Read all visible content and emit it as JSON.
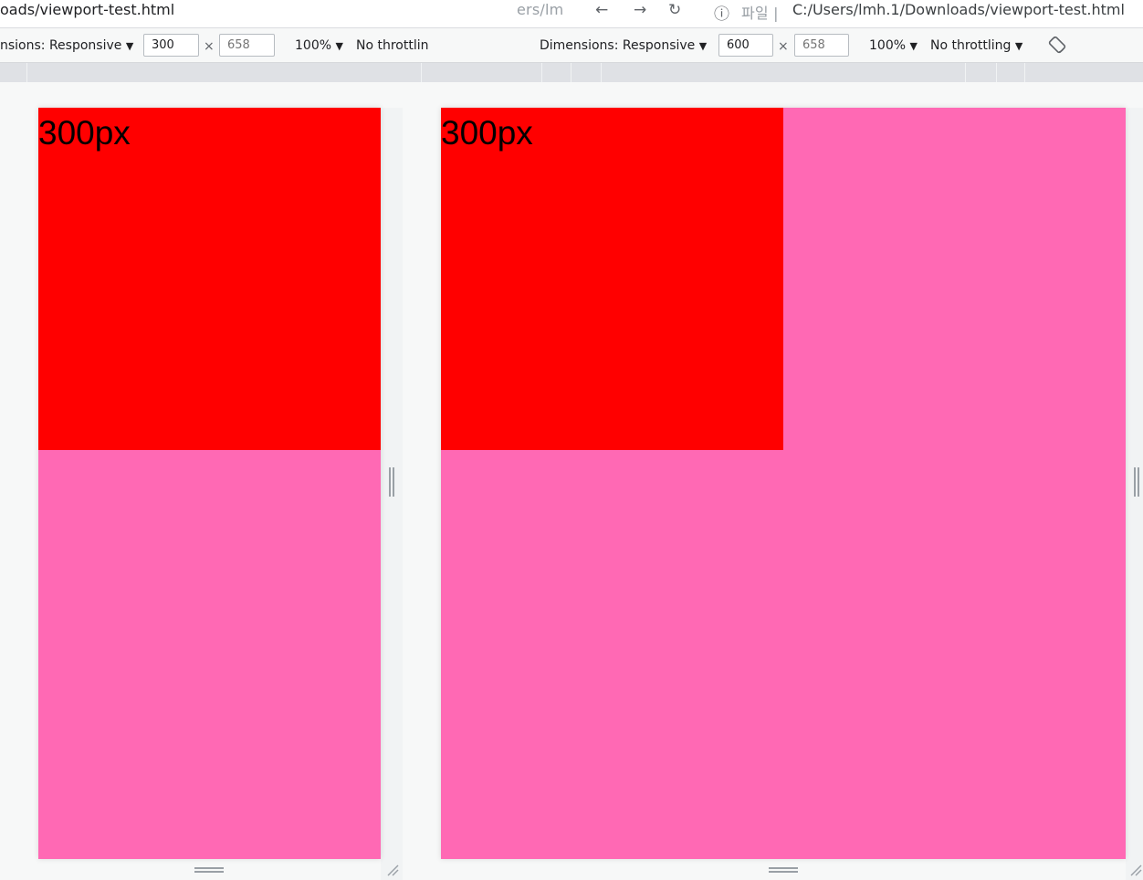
{
  "address_bar": {
    "url_left": "oads/viewport-test.html",
    "url_right": "C:/Users/lmh.1/Downloads/viewport-test.html",
    "ghost_text_a": "ers/lm",
    "ghost_text_b": "파일 |",
    "back_icon": "back-arrow-icon",
    "forward_icon": "forward-arrow-icon",
    "reload_icon": "reload-icon",
    "info_icon": "info-icon"
  },
  "toolbars": [
    {
      "dimensions_label": "nsions: Responsive",
      "width_value": "300",
      "height_placeholder": "658",
      "times": "×",
      "zoom_label": "100%",
      "throttle_label": "No throttlin",
      "dropdown_caret": "▼"
    },
    {
      "dimensions_label": "Dimensions: Responsive",
      "width_value": "600",
      "height_placeholder": "658",
      "times": "×",
      "zoom_label": "100%",
      "throttle_label": "No throttling",
      "dropdown_caret": "▼",
      "rotate_icon": "rotate-icon"
    }
  ],
  "viewports": [
    {
      "label": "300px",
      "box_color": "#ff0000",
      "background_color": "#ff69b4"
    },
    {
      "label": "300px",
      "box_color": "#ff0000",
      "background_color": "#ff69b4"
    }
  ],
  "colors": {
    "box_red": "#ff0000",
    "page_pink": "#ff69b4",
    "chrome_bg": "#f7f8f8",
    "ruler_bg": "#dfe1e5"
  }
}
